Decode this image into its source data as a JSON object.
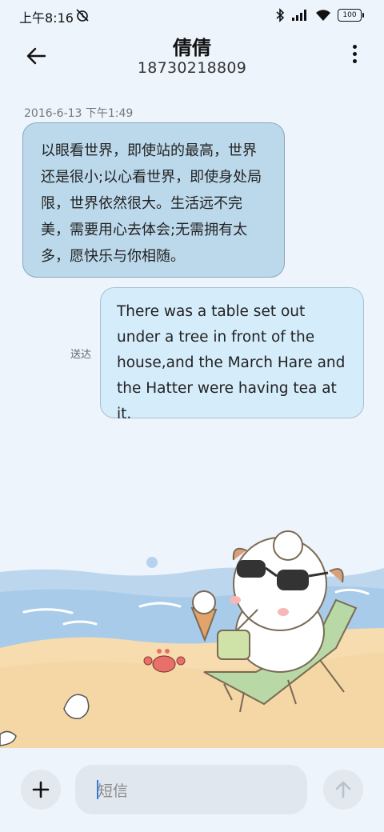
{
  "status_bar": {
    "time": "上午8:16",
    "battery": "100"
  },
  "header": {
    "contact_name": "倩倩",
    "phone_number": "18730218809"
  },
  "conversation": {
    "timestamp": "2016-6-13 下午1:49",
    "received_message": "以眼看世界，即使站的最高，世界还是很小;以心看世界，即使身处局限，世界依然很大。生活远不完美，需要用心去体会;无需拥有太多，愿快乐与你相随。",
    "sent_message": "There was a table set out under a tree in front of the house,and the March Hare and the Hatter were having tea at it.",
    "delivery_status": "送达"
  },
  "composer": {
    "placeholder": "短信"
  },
  "icons": {
    "back": "back-arrow-icon",
    "menu": "more-vertical-icon",
    "add": "plus-icon",
    "send": "send-arrow-up-icon"
  },
  "colors": {
    "background": "#eef4fc",
    "received_bubble": "#bcd9ec",
    "sent_bubble": "#d5ecfa",
    "cursor": "#3a78d8"
  }
}
